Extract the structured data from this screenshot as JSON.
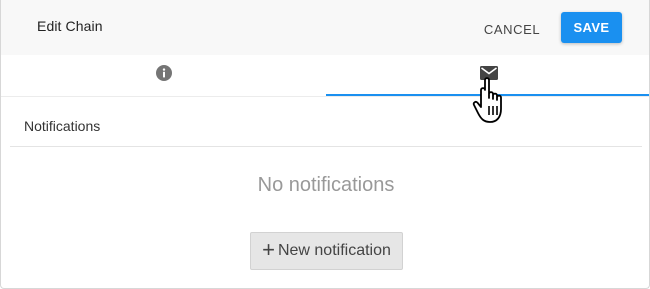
{
  "header": {
    "title": "Edit Chain",
    "cancel_label": "CANCEL",
    "save_label": "SAVE"
  },
  "tabs": [
    {
      "icon": "info-icon",
      "active": false
    },
    {
      "icon": "envelope-icon",
      "active": true
    }
  ],
  "notifications": {
    "section_label": "Notifications",
    "empty_text": "No notifications",
    "new_button_icon": "+",
    "new_button_label": "New notification"
  },
  "colors": {
    "accent": "#1a90f0",
    "header_bg": "#f8f8f8",
    "muted_text": "#999999",
    "icon_gray": "#757575"
  },
  "cursor": {
    "icon": "hand-pointer-icon"
  }
}
